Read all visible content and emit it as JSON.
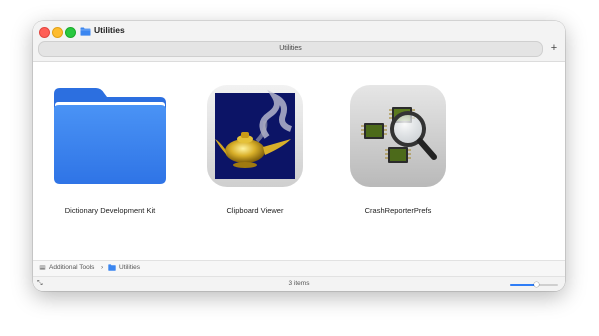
{
  "window": {
    "title": "Utilities",
    "tab_title": "Utilities",
    "new_tab_label": "+"
  },
  "items": [
    {
      "name": "Dictionary Development Kit",
      "icon": "folder-icon"
    },
    {
      "name": "Clipboard Viewer",
      "icon": "genie-lamp-icon"
    },
    {
      "name": "CrashReporterPrefs",
      "icon": "magnifier-chips-icon"
    }
  ],
  "pathbar": {
    "segments": [
      "Additional Tools",
      "Utilities"
    ],
    "separator": "›"
  },
  "status": {
    "count": "3 items",
    "zoom_level": 0.55
  },
  "colors": {
    "folder_blue": "#3b86f0",
    "accent": "#2f7df6",
    "close": "#ff5f57",
    "minimize": "#febc2e",
    "maximize": "#28c840"
  }
}
